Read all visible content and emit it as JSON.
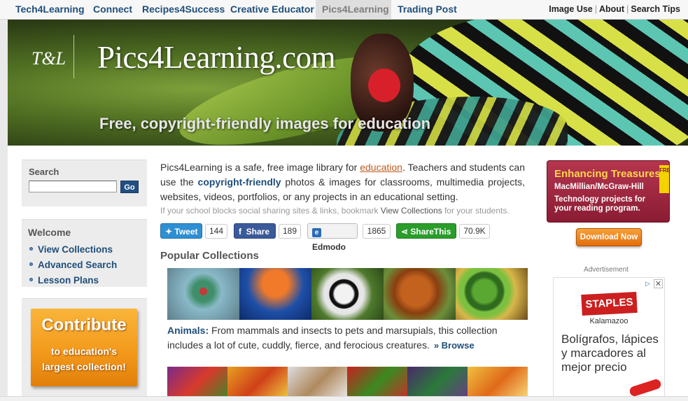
{
  "topnav": {
    "tabs": [
      {
        "label": "Tech4Learning"
      },
      {
        "label": "Connect"
      },
      {
        "label": "Recipes4Success"
      },
      {
        "label": "Creative Educator"
      },
      {
        "label": "Pics4Learning"
      },
      {
        "label": "Trading Post"
      }
    ],
    "active_tab": "Pics4Learning",
    "right_links": [
      "Image Use",
      "About",
      "Search Tips"
    ]
  },
  "banner": {
    "logo_text": "T&L",
    "site_title": "Pics4Learning.com",
    "tagline": "Free, copyright-friendly images for education"
  },
  "sidebar": {
    "search": {
      "heading": "Search",
      "value": "",
      "go_label": "Go"
    },
    "welcome": {
      "heading": "Welcome",
      "items": [
        {
          "label": "View Collections"
        },
        {
          "label": "Advanced Search"
        },
        {
          "label": "Lesson Plans"
        }
      ]
    },
    "contribute": {
      "title": "Contribute",
      "line1": "to education's",
      "line2": "largest collection!"
    }
  },
  "intro": {
    "p1": "Pics4Learning is a safe, free image library for ",
    "link": "education",
    "p2": ". Teachers and students can use the ",
    "bold": "copyright-friendly",
    "p3": " photos & images for classrooms, multimedia projects, websites, videos, portfolios, or any projects in an educational setting."
  },
  "note": {
    "pre": "If your school blocks social sharing sites & links, bookmark ",
    "link": "View Collections",
    "post": " for your students."
  },
  "social": {
    "tweet": {
      "label": "Tweet",
      "count": "144"
    },
    "share": {
      "label": "Share",
      "count": "189"
    },
    "edmodo": {
      "label": "Edmodo",
      "count": "1865"
    },
    "sharethis": {
      "label": "ShareThis",
      "count": "70.9K"
    }
  },
  "popular": {
    "heading": "Popular Collections",
    "animals": {
      "title": "Animals:",
      "desc": " From mammals and insects to pets and marsupials, this collection includes a lot of cute, cuddly, fierce, and ferocious creatures.",
      "browse": "» Browse"
    }
  },
  "ad1": {
    "headline": "Enhancing Treasures: Ca",
    "publisher": "MacMillian/McGraw-Hill",
    "body": "Technology projects for your reading program.",
    "free_badge": "FREE",
    "download": "Download Now"
  },
  "ad2": {
    "label": "Advertisement",
    "brand": "STAPLES",
    "city": "Kalamazoo",
    "text": "Bolígrafos, lápices y marcadores al mejor precio"
  },
  "colors": {
    "link_blue": "#1f4e7a",
    "accent_orange": "#c05a20",
    "twitter": "#2f8fd3",
    "facebook": "#3b5a9a",
    "sharethis": "#2a9d2a"
  }
}
